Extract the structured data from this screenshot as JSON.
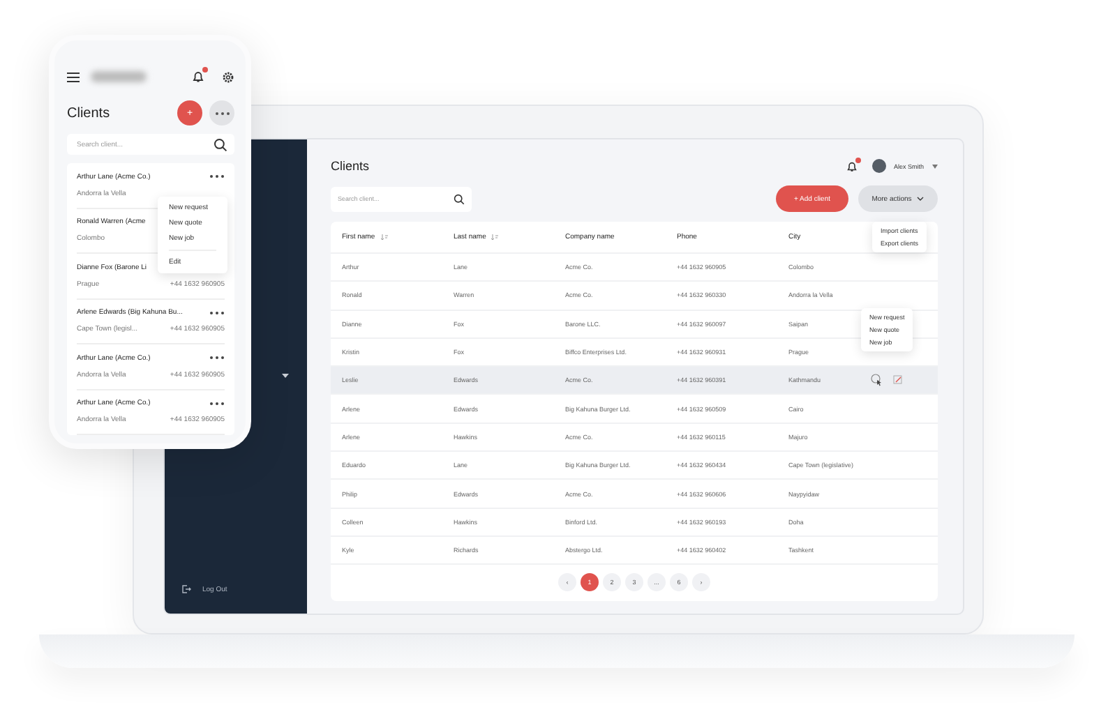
{
  "laptop": {
    "sidebar": {
      "logout": "Log Out"
    },
    "header": {
      "title": "Clients",
      "user": {
        "name": "Alex Smith"
      }
    },
    "search": {
      "placeholder": "Search client..."
    },
    "add_button": "+ Add client",
    "more_button": "More actions",
    "more_menu": [
      "Import clients",
      "Export clients"
    ],
    "table": {
      "columns": [
        {
          "label": "First name",
          "sortable": true
        },
        {
          "label": "Last name",
          "sortable": true
        },
        {
          "label": "Company name",
          "sortable": false
        },
        {
          "label": "Phone",
          "sortable": false
        },
        {
          "label": "City",
          "sortable": false
        }
      ],
      "rows": [
        {
          "cells": [
            "Arthur",
            "Lane",
            "Acme Co.",
            "+44 1632 960905",
            "Colombo"
          ],
          "hovered": false
        },
        {
          "cells": [
            "Ronald",
            "Warren",
            "Acme Co.",
            "+44 1632 960330",
            "Andorra la Vella"
          ],
          "hovered": false
        },
        {
          "cells": [
            "Dianne",
            "Fox",
            "Barone LLC.",
            "+44 1632 960097",
            "Saipan"
          ],
          "hovered": false
        },
        {
          "cells": [
            "Kristin",
            "Fox",
            "Biffco Enterprises Ltd.",
            "+44 1632 960931",
            "Prague"
          ],
          "hovered": false
        },
        {
          "cells": [
            "Leslie",
            "Edwards",
            "Acme Co.",
            "+44 1632 960391",
            "Kathmandu"
          ],
          "hovered": true
        },
        {
          "cells": [
            "Arlene",
            "Edwards",
            "Big Kahuna Burger Ltd.",
            "+44 1632 960509",
            "Cairo"
          ],
          "hovered": false
        },
        {
          "cells": [
            "Arlene",
            "Hawkins",
            "Acme Co.",
            "+44 1632 960115",
            "Majuro"
          ],
          "hovered": false
        },
        {
          "cells": [
            "Eduardo",
            "Lane",
            "Big Kahuna Burger Ltd.",
            "+44 1632 960434",
            "Cape Town (legislative)"
          ],
          "hovered": false
        },
        {
          "cells": [
            "Philip",
            "Edwards",
            "Acme Co.",
            "+44 1632 960606",
            "Naypyidaw"
          ],
          "hovered": false
        },
        {
          "cells": [
            "Colleen",
            "Hawkins",
            "Binford Ltd.",
            "+44 1632 960193",
            "Doha"
          ],
          "hovered": false
        },
        {
          "cells": [
            "Kyle",
            "Richards",
            "Abstergo Ltd.",
            "+44 1632 960402",
            "Tashkent"
          ],
          "hovered": false
        }
      ]
    },
    "row_menu": [
      "New request",
      "New quote",
      "New job"
    ],
    "pagination": [
      {
        "label": "‹",
        "selected": false
      },
      {
        "label": "1",
        "selected": true
      },
      {
        "label": "2",
        "selected": false
      },
      {
        "label": "3",
        "selected": false
      },
      {
        "label": "...",
        "selected": false
      },
      {
        "label": "6",
        "selected": false
      },
      {
        "label": "›",
        "selected": false
      }
    ]
  },
  "phone": {
    "title": "Clients",
    "add_button": "+",
    "search": {
      "placeholder": "Search client..."
    },
    "clients": [
      {
        "name": "Arthur Lane (Acme Co.)",
        "city": "Andorra la Vella"
      },
      {
        "name": "Ronald Warren (Acme",
        "city": "Colombo"
      },
      {
        "name": "Dianne Fox (Barone Li",
        "city": "Prague",
        "phone": "+44 1632 960905"
      },
      {
        "name": "Arlene Edwards (Big Kahuna Bu...",
        "city": "Cape Town (legisl...",
        "phone": "+44 1632 960905"
      },
      {
        "name": "Arthur Lane (Acme Co.)",
        "city": "Andorra la Vella",
        "phone": "+44 1632 960905"
      },
      {
        "name": "Arthur Lane (Acme Co.)",
        "city": "Andorra la Vella",
        "phone": "+44 1632 960905"
      }
    ],
    "menu": [
      "New request",
      "New quote",
      "New job",
      "Edit"
    ]
  }
}
